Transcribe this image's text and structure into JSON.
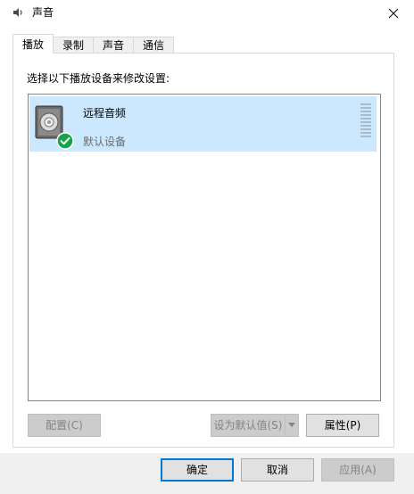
{
  "window": {
    "title": "声音",
    "close_glyph": "✕"
  },
  "tabs": [
    {
      "label": "播放",
      "active": true
    },
    {
      "label": "录制",
      "active": false
    },
    {
      "label": "声音",
      "active": false
    },
    {
      "label": "通信",
      "active": false
    }
  ],
  "playback": {
    "instruction": "选择以下播放设备来修改设置:",
    "devices": [
      {
        "name": "远程音频",
        "status": "默认设备",
        "icon": "speaker-icon",
        "badge_icon": "check-icon",
        "selected": true
      }
    ],
    "configure_label": "配置(C)",
    "set_default_label": "设为默认值(S)",
    "properties_label": "属性(P)"
  },
  "footer": {
    "ok_label": "确定",
    "cancel_label": "取消",
    "apply_label": "应用(A)"
  },
  "colors": {
    "selection": "#cce8ff",
    "accent": "#0078d7",
    "check": "#16a34a"
  }
}
